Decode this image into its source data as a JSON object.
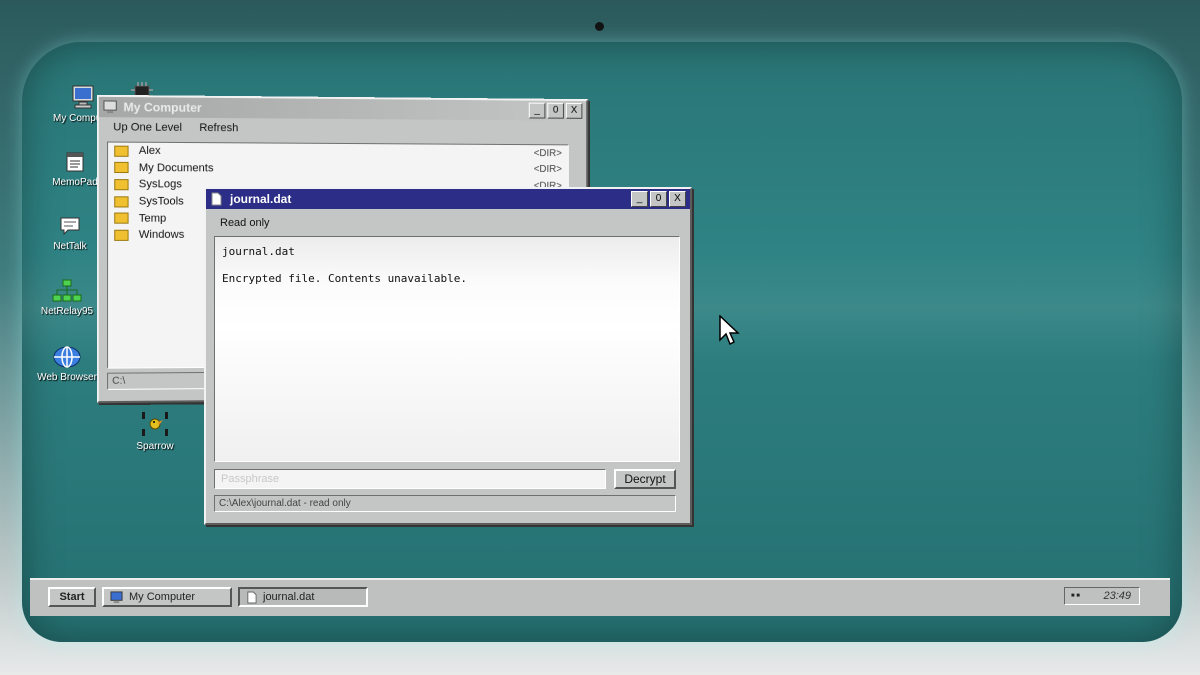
{
  "desktop": {
    "icons": [
      {
        "label": "My Computer",
        "icon": "computer-icon"
      },
      {
        "label": "",
        "icon": "chip-icon"
      },
      {
        "label": "MemoPad",
        "icon": "notepad-icon"
      },
      {
        "label": "NetTalk",
        "icon": "chat-icon"
      },
      {
        "label": "NetRelay95",
        "icon": "network-icon"
      },
      {
        "label": "Web Browser",
        "icon": "globe-icon"
      },
      {
        "label": "Sparrow",
        "icon": "bird-icon"
      }
    ]
  },
  "explorer": {
    "title": "My Computer",
    "menu": {
      "up": "Up One Level",
      "refresh": "Refresh"
    },
    "items": [
      {
        "name": "Alex",
        "tag": "<DIR>"
      },
      {
        "name": "My Documents",
        "tag": "<DIR>"
      },
      {
        "name": "SysLogs",
        "tag": "<DIR>"
      },
      {
        "name": "SysTools",
        "tag": ""
      },
      {
        "name": "Temp",
        "tag": ""
      },
      {
        "name": "Windows",
        "tag": ""
      }
    ],
    "status": "C:\\",
    "controls": {
      "minimize": "_",
      "maximize": "0",
      "close": "X"
    }
  },
  "journal": {
    "title": "journal.dat",
    "mode": "Read only",
    "line1": "journal.dat",
    "line2": "Encrypted file. Contents unavailable.",
    "passphrase_placeholder": "Passphrase",
    "decrypt_label": "Decrypt",
    "status": "C:\\Alex\\journal.dat - read only",
    "controls": {
      "minimize": "_",
      "maximize": "0",
      "close": "X"
    }
  },
  "taskbar": {
    "start": "Start",
    "tasks": [
      {
        "label": "My Computer",
        "icon": "computer-icon"
      },
      {
        "label": "journal.dat",
        "icon": "document-icon"
      }
    ],
    "clock": "23:49",
    "tray_dots": "■ ■"
  },
  "colors": {
    "desktop": "#2f8384",
    "active_title": "#2b2d86",
    "window_face": "#c4c6c6"
  }
}
